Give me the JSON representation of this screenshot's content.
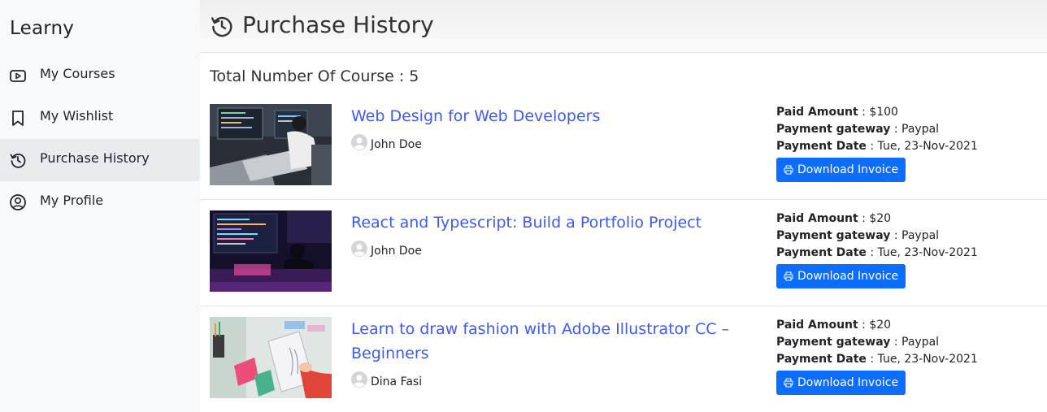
{
  "sidebar": {
    "brand": "Learny",
    "items": [
      {
        "label": "My Courses",
        "icon": "play-video-icon"
      },
      {
        "label": "My Wishlist",
        "icon": "bookmark-icon"
      },
      {
        "label": "Purchase History",
        "icon": "history-icon",
        "active": true
      },
      {
        "label": "My Profile",
        "icon": "user-circle-icon"
      }
    ]
  },
  "header": {
    "title": "Purchase History",
    "icon": "history-icon"
  },
  "summary": {
    "total_text": "Total Number Of Course : 5"
  },
  "labels": {
    "paid_amount": "Paid Amount",
    "payment_gateway": "Payment gateway",
    "payment_date": "Payment Date",
    "download": "Download Invoice"
  },
  "purchases": [
    {
      "title": "Web Design for Web Developers",
      "author": "John Doe",
      "amount": "$100",
      "gateway": "Paypal",
      "date": "Tue, 23-Nov-2021"
    },
    {
      "title": "React and Typescript: Build a Portfolio Project",
      "author": "John Doe",
      "amount": "$20",
      "gateway": "Paypal",
      "date": "Tue, 23-Nov-2021"
    },
    {
      "title": "Learn to draw fashion with Adobe Illustrator CC – Beginners",
      "author": "Dina Fasi",
      "amount": "$20",
      "gateway": "Paypal",
      "date": "Tue, 23-Nov-2021"
    }
  ],
  "colors": {
    "link": "#3d5af1",
    "button": "#0d6efd",
    "sidebar_bg": "#f8f9fa",
    "active_bg": "#e9ecef"
  }
}
